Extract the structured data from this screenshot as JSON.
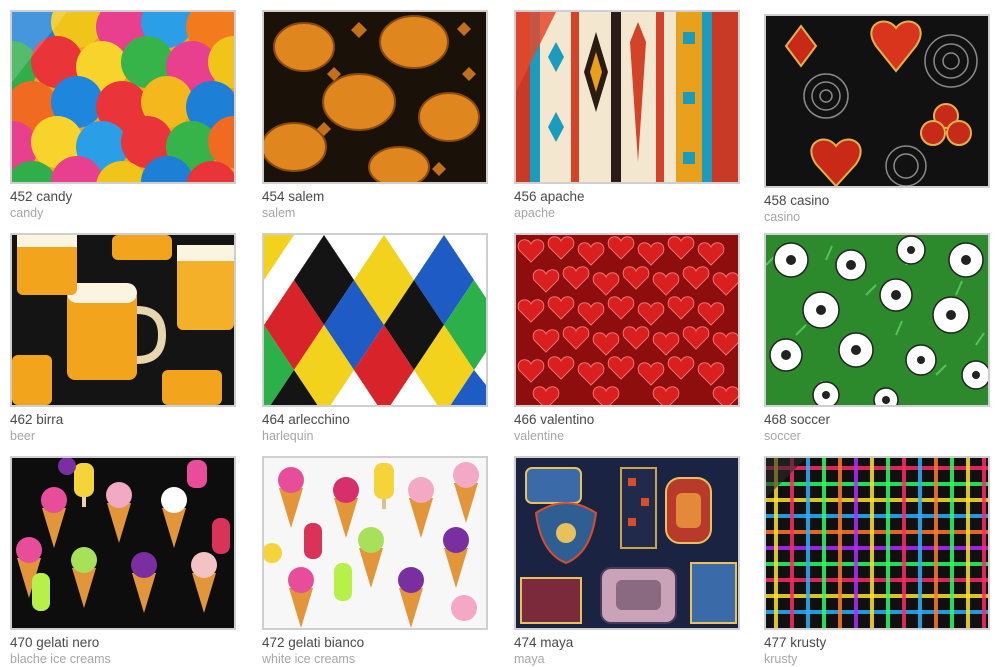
{
  "products": [
    {
      "code_name": "452 candy",
      "subtitle": "candy"
    },
    {
      "code_name": "454 salem",
      "subtitle": "salem"
    },
    {
      "code_name": "456 apache",
      "subtitle": "apache"
    },
    {
      "code_name": "458 casino",
      "subtitle": "casino"
    },
    {
      "code_name": "462 birra",
      "subtitle": "beer"
    },
    {
      "code_name": "464 arlecchino",
      "subtitle": "harlequin"
    },
    {
      "code_name": "466 valentino",
      "subtitle": "valentine"
    },
    {
      "code_name": "468 soccer",
      "subtitle": "soccer"
    },
    {
      "code_name": "470 gelati nero",
      "subtitle": "blache ice creams"
    },
    {
      "code_name": "472 gelati bianco",
      "subtitle": "white ice creams"
    },
    {
      "code_name": "474 maya",
      "subtitle": "maya"
    },
    {
      "code_name": "477 krusty",
      "subtitle": "krusty"
    }
  ]
}
